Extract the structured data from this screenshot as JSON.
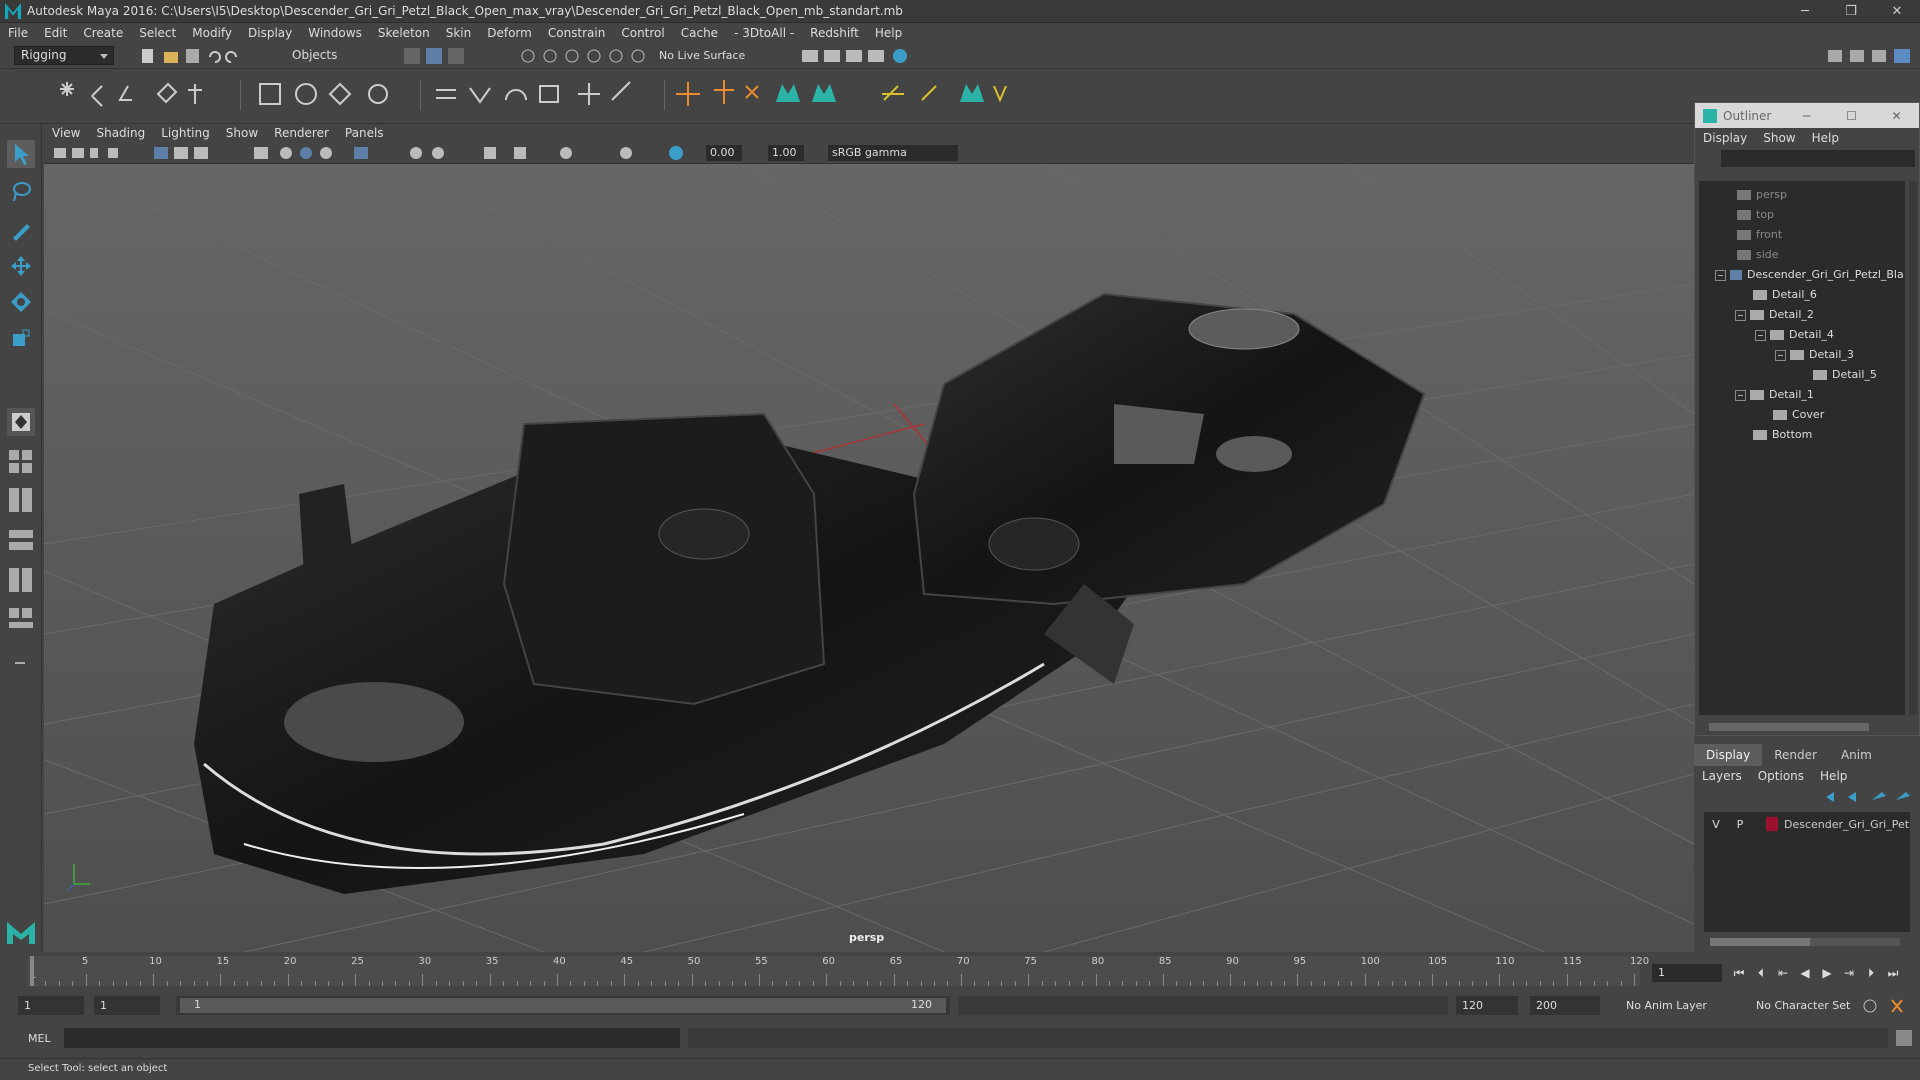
{
  "window": {
    "title": "Autodesk Maya 2016: C:\\Users\\I5\\Desktop\\Descender_Gri_Gri_Petzl_Black_Open_max_vray\\Descender_Gri_Gri_Petzl_Black_Open_mb_standart.mb",
    "minimize": "─",
    "restore": "❐",
    "close": "✕"
  },
  "menubar": [
    "File",
    "Edit",
    "Create",
    "Select",
    "Modify",
    "Display",
    "Windows",
    "Skeleton",
    "Skin",
    "Deform",
    "Constrain",
    "Control",
    "Cache",
    "- 3DtoAll -",
    "Redshift",
    "Help"
  ],
  "statusline": {
    "mode": "Rigging",
    "selection_mask": "Objects",
    "live_surface": "No Live Surface"
  },
  "viewport": {
    "menu": [
      "View",
      "Shading",
      "Lighting",
      "Show",
      "Renderer",
      "Panels"
    ],
    "exposure": "0.00",
    "gamma": "1.00",
    "color_space": "sRGB gamma",
    "camera_label": "persp"
  },
  "outliner": {
    "title": "Outliner",
    "menu": [
      "Display",
      "Show",
      "Help"
    ],
    "cameras": [
      "persp",
      "top",
      "front",
      "side"
    ],
    "root": "Descender_Gri_Gri_Petzl_Bla",
    "children": [
      "Detail_6",
      "Detail_2",
      "Detail_4",
      "Detail_3",
      "Detail_5",
      "Detail_1",
      "Cover",
      "Bottom"
    ]
  },
  "layer_editor": {
    "tabs": [
      "Display",
      "Render",
      "Anim"
    ],
    "menu": [
      "Layers",
      "Options",
      "Help"
    ],
    "layer": {
      "v": "V",
      "p": "P",
      "name": "Descender_Gri_Gri_Pet",
      "color": "#9a1030"
    }
  },
  "timeline": {
    "labels": [
      "5",
      "10",
      "15",
      "20",
      "25",
      "30",
      "35",
      "40",
      "45",
      "50",
      "55",
      "60",
      "65",
      "70",
      "75",
      "80",
      "85",
      "90",
      "95",
      "100",
      "105",
      "110",
      "115",
      "120"
    ],
    "start_label": "1",
    "current_frame": "1"
  },
  "range": {
    "start": "1",
    "playback_start": "1",
    "slider_start": "1",
    "slider_end": "120",
    "playback_end": "120",
    "end": "200",
    "anim_layer": "No Anim Layer",
    "character_set": "No Character Set"
  },
  "command": {
    "mel": "MEL",
    "help": "Select Tool: select an object"
  }
}
